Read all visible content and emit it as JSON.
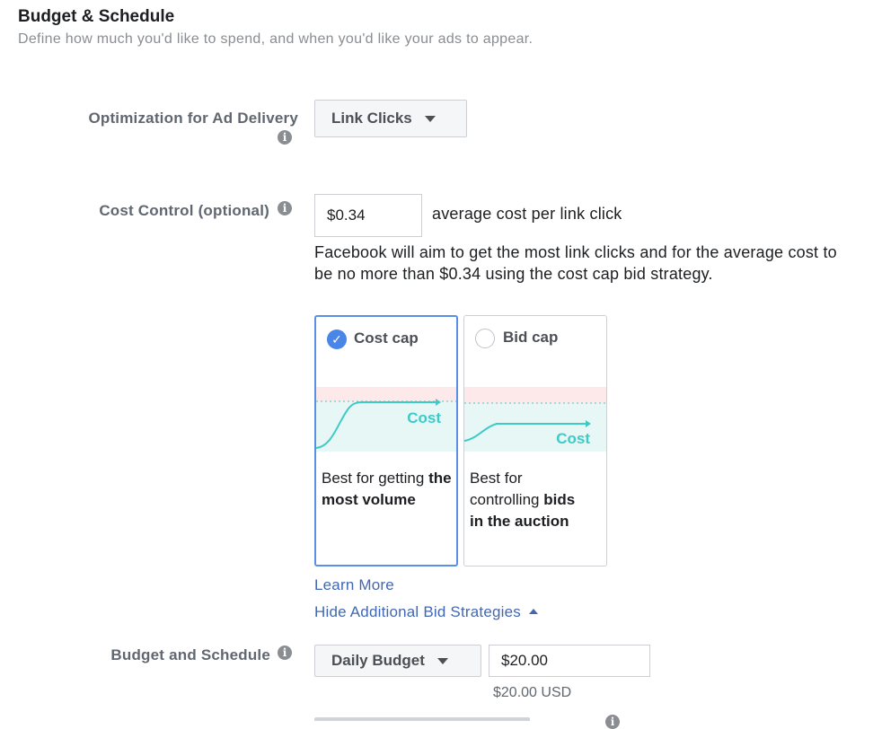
{
  "header": {
    "title": "Budget & Schedule",
    "subtitle": "Define how much you'd like to spend, and when you'd like your ads to appear."
  },
  "optimization": {
    "label": "Optimization for Ad Delivery",
    "info_icon": "info-icon",
    "dropdown_value": "Link Clicks"
  },
  "cost_control": {
    "label": "Cost Control (optional)",
    "info_icon": "info-icon",
    "amount_value": "$0.34",
    "amount_suffix": "average cost per link click",
    "description": "Facebook will aim to get the most link clicks and for the average cost to be no more than $0.34 using the cost cap bid strategy."
  },
  "strategies": [
    {
      "title": "Cost cap",
      "selected": true,
      "chart_label": "Cost",
      "desc_plain": "Best for getting",
      "desc_bold": "the most volume"
    },
    {
      "title": "Bid cap",
      "selected": false,
      "chart_label": "Cost",
      "desc_plain": "Best for controlling",
      "desc_bold": "bids in the auction"
    }
  ],
  "links": {
    "learn_more": "Learn More",
    "hide_strategies": "Hide Additional Bid Strategies"
  },
  "budget": {
    "label": "Budget and Schedule",
    "info_icon": "info-icon",
    "type_value": "Daily Budget",
    "amount_value": "$20.00",
    "amount_usd": "$20.00 USD"
  },
  "colors": {
    "accent": "#4267b2",
    "selected_border": "#5b8ee6",
    "chart_teal": "#3ecbc6",
    "chart_band_pink": "#fde8ea",
    "chart_band_teal": "#e6f7f6"
  }
}
